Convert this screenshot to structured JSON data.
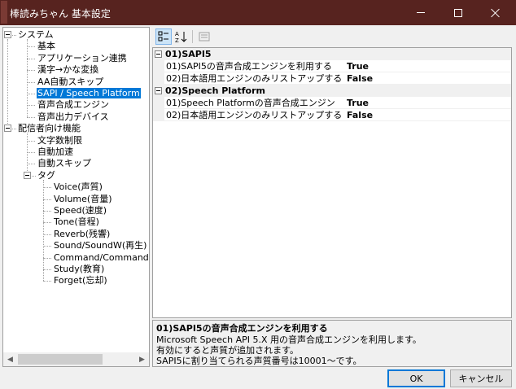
{
  "window": {
    "title": "棒読みちゃん 基本設定"
  },
  "tree": {
    "nodes": [
      {
        "label": "システム",
        "level": 0,
        "expanded": true
      },
      {
        "label": "基本",
        "level": 1
      },
      {
        "label": "アプリケーション連携",
        "level": 1
      },
      {
        "label": "漢字→かな変換",
        "level": 1
      },
      {
        "label": "AA自動スキップ",
        "level": 1
      },
      {
        "label": "SAPI / Speech Platform",
        "level": 1,
        "selected": true
      },
      {
        "label": "音声合成エンジン",
        "level": 1
      },
      {
        "label": "音声出力デバイス",
        "level": 1
      },
      {
        "label": "配信者向け機能",
        "level": 0,
        "expanded": true
      },
      {
        "label": "文字数制限",
        "level": 1
      },
      {
        "label": "自動加速",
        "level": 1
      },
      {
        "label": "自動スキップ",
        "level": 1
      },
      {
        "label": "タグ",
        "level": 1,
        "expanded": true
      },
      {
        "label": "Voice(声質)",
        "level": 2
      },
      {
        "label": "Volume(音量)",
        "level": 2
      },
      {
        "label": "Speed(速度)",
        "level": 2
      },
      {
        "label": "Tone(音程)",
        "level": 2
      },
      {
        "label": "Reverb(残響)",
        "level": 2
      },
      {
        "label": "Sound/SoundW(再生)",
        "level": 2
      },
      {
        "label": "Command/CommandW",
        "level": 2
      },
      {
        "label": "Study(教育)",
        "level": 2
      },
      {
        "label": "Forget(忘却)",
        "level": 2
      }
    ]
  },
  "toolbar": {
    "categorized_icon": "categorized-icon",
    "alphabetical_icon": "sort-alphabetical-icon",
    "property_pages_icon": "property-pages-icon"
  },
  "grid": {
    "categories": [
      {
        "label": "01)SAPI5",
        "properties": [
          {
            "name": "01)SAPI5の音声合成エンジンを利用する",
            "value": "True"
          },
          {
            "name": "02)日本語用エンジンのみリストアップする",
            "value": "False"
          }
        ]
      },
      {
        "label": "02)Speech Platform",
        "properties": [
          {
            "name": "01)Speech Platformの音声合成エンジン",
            "value": "True"
          },
          {
            "name": "02)日本語用エンジンのみリストアップする",
            "value": "False"
          }
        ]
      }
    ]
  },
  "description": {
    "title": "01)SAPI5の音声合成エンジンを利用する",
    "lines": [
      "Microsoft Speech API 5.X 用の音声合成エンジンを利用します。",
      "有効にすると声質が追加されます。",
      "SAPI5に割り当てられる声質番号は10001～です。"
    ]
  },
  "buttons": {
    "ok": "OK",
    "cancel": "キャンセル"
  }
}
